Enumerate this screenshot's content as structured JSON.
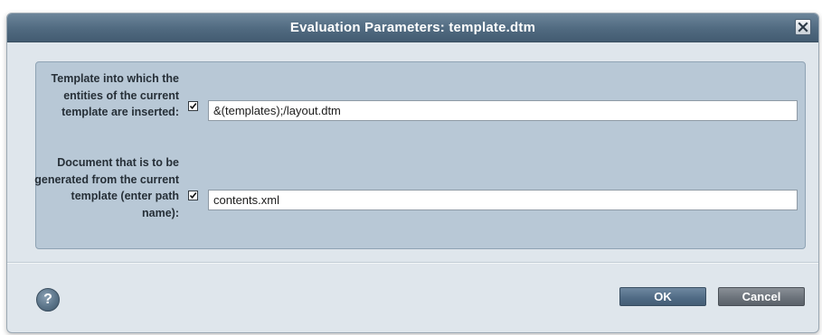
{
  "dialog": {
    "title": "Evaluation Parameters: template.dtm",
    "close_icon": "close-icon"
  },
  "params": [
    {
      "label": "Template into which the entities of the current template are inserted:",
      "checked": true,
      "value": "&(templates);/layout.dtm"
    },
    {
      "label": "Document that is to be generated from the current template (enter path name):",
      "checked": true,
      "value": "contents.xml"
    }
  ],
  "footer": {
    "help_label": "?",
    "help_icon": "help-icon",
    "ok_label": "OK",
    "cancel_label": "Cancel"
  },
  "colors": {
    "titlebar": "#506a80",
    "panel": "#b8c8d6",
    "ok_button": "#4f6a84",
    "cancel_button": "#6a7179"
  }
}
